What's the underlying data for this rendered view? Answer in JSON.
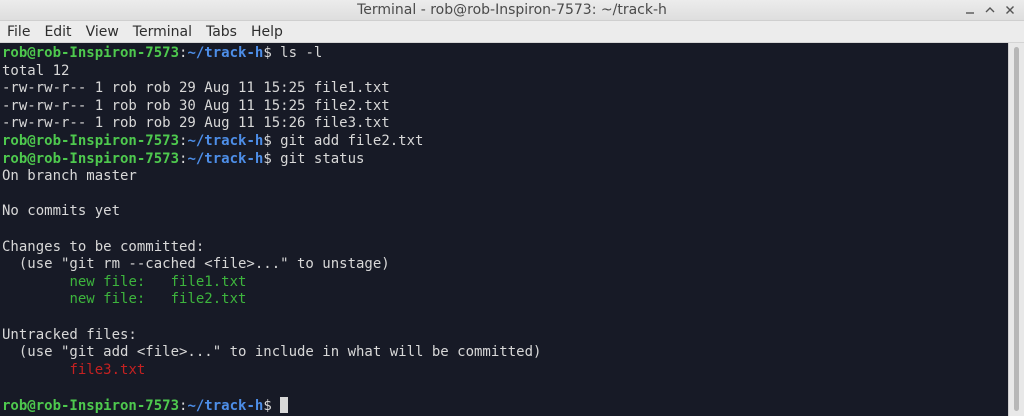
{
  "window": {
    "title": "Terminal - rob@rob-Inspiron-7573: ~/track-h"
  },
  "menu": {
    "items": [
      "File",
      "Edit",
      "View",
      "Terminal",
      "Tabs",
      "Help"
    ]
  },
  "prompt": {
    "user_host": "rob@rob-Inspiron-7573",
    "colon": ":",
    "path": "~/track-h",
    "symbol": "$ "
  },
  "terminal": {
    "cmd1": "ls -l",
    "ls_total": "total 12",
    "ls_line1": "-rw-rw-r-- 1 rob rob 29 Aug 11 15:25 file1.txt",
    "ls_line2": "-rw-rw-r-- 1 rob rob 30 Aug 11 15:25 file2.txt",
    "ls_line3": "-rw-rw-r-- 1 rob rob 29 Aug 11 15:26 file3.txt",
    "cmd2": "git add file2.txt",
    "cmd3": "git status",
    "status_branch": "On branch master",
    "status_commits": "No commits yet",
    "status_changes_header": "Changes to be committed:",
    "status_changes_hint": "  (use \"git rm --cached <file>...\" to unstage)",
    "staged_1": "\tnew file:   file1.txt",
    "staged_2": "\tnew file:   file2.txt",
    "status_untracked_header": "Untracked files:",
    "status_untracked_hint": "  (use \"git add <file>...\" to include in what will be committed)",
    "untracked_1": "\tfile3.txt"
  },
  "colors": {
    "background": "#171a26",
    "prompt_user": "#4ec94e",
    "prompt_path": "#4d8ee8",
    "staged": "#3db53d",
    "untracked": "#c42121"
  }
}
